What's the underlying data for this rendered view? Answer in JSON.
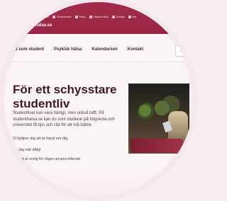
{
  "browser": {
    "url": "studenthalsa.se",
    "bookmarks": [
      "Gmail",
      "Kalender",
      "Studenthälsa",
      "Hälsa",
      "Psykisk hälsa",
      "Kontakt",
      "Mer"
    ]
  },
  "site": {
    "title": "studenthalsa.se",
    "nav": [
      "Vad som student",
      "Psykisk hälsa",
      "Kalendarium",
      "Kontakt"
    ],
    "search_icon": "search-icon",
    "hero_title": "För ett schysstare studentliv",
    "hero_text": "Studentlivet kan vara härligt, men också tufft. På studenthalsa.se kan du som studerar på högskola och universitet få tips och råd för att må bättre.",
    "help_text": "Vi hjälper dig att ta hand om dig.",
    "list_items": [
      "Jag mår dåligt",
      "Jag är orolig för någon annans mående"
    ]
  },
  "colors": {
    "brand": "#9d2947",
    "text": "#3f1820"
  }
}
